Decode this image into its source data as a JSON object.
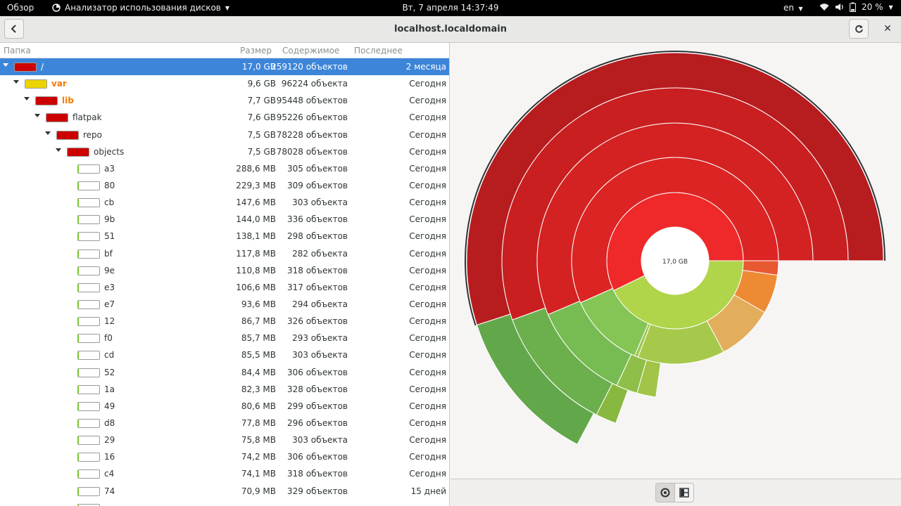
{
  "topbar": {
    "overview": "Обзор",
    "app_name": "Анализатор использования дисков",
    "clock": "Вт, 7 апреля  14:37:49",
    "lang": "en",
    "battery": "20 %"
  },
  "header": {
    "title": "localhost.localdomain"
  },
  "columns": {
    "name": "Папка",
    "size": "Размер",
    "contents": "Содержимое",
    "modified": "Последнее изменение"
  },
  "rows": [
    {
      "name": "/",
      "size": "17,0 GB",
      "contents": "259120 объектов",
      "modified": "2 месяца",
      "level": 0,
      "expander": true,
      "fill": 1.0,
      "color": "#cc0000"
    },
    {
      "name": "var",
      "size": "9,6 GB",
      "contents": "96224 объекта",
      "modified": "Сегодня",
      "level": 1,
      "expander": true,
      "fill": 1.0,
      "color": "#edd400"
    },
    {
      "name": "lib",
      "size": "7,7 GB",
      "contents": "95448 объектов",
      "modified": "Сегодня",
      "level": 2,
      "expander": true,
      "fill": 1.0,
      "color": "#cc0000"
    },
    {
      "name": "flatpak",
      "size": "7,6 GB",
      "contents": "95226 объектов",
      "modified": "Сегодня",
      "level": 3,
      "expander": true,
      "fill": 1.0,
      "color": "#cc0000"
    },
    {
      "name": "repo",
      "size": "7,5 GB",
      "contents": "78228 объектов",
      "modified": "Сегодня",
      "level": 4,
      "expander": true,
      "fill": 1.0,
      "color": "#cc0000"
    },
    {
      "name": "objects",
      "size": "7,5 GB",
      "contents": "78028 объектов",
      "modified": "Сегодня",
      "level": 5,
      "expander": true,
      "fill": 1.0,
      "color": "#cc0000"
    },
    {
      "name": "a3",
      "size": "288,6 MB",
      "contents": "305 объектов",
      "modified": "Сегодня",
      "level": 6,
      "expander": false,
      "fill": 0.04,
      "color": "#73d216"
    },
    {
      "name": "80",
      "size": "229,3 MB",
      "contents": "309 объектов",
      "modified": "Сегодня",
      "level": 6,
      "expander": false,
      "fill": 0.03,
      "color": "#73d216"
    },
    {
      "name": "cb",
      "size": "147,6 MB",
      "contents": "303 объекта",
      "modified": "Сегодня",
      "level": 6,
      "expander": false,
      "fill": 0.02,
      "color": "#73d216"
    },
    {
      "name": "9b",
      "size": "144,0 MB",
      "contents": "336 объектов",
      "modified": "Сегодня",
      "level": 6,
      "expander": false,
      "fill": 0.02,
      "color": "#73d216"
    },
    {
      "name": "51",
      "size": "138,1 MB",
      "contents": "298 объектов",
      "modified": "Сегодня",
      "level": 6,
      "expander": false,
      "fill": 0.02,
      "color": "#73d216"
    },
    {
      "name": "bf",
      "size": "117,8 MB",
      "contents": "282 объекта",
      "modified": "Сегодня",
      "level": 6,
      "expander": false,
      "fill": 0.02,
      "color": "#73d216"
    },
    {
      "name": "9e",
      "size": "110,8 MB",
      "contents": "318 объектов",
      "modified": "Сегодня",
      "level": 6,
      "expander": false,
      "fill": 0.01,
      "color": "#73d216"
    },
    {
      "name": "e3",
      "size": "106,6 MB",
      "contents": "317 объектов",
      "modified": "Сегодня",
      "level": 6,
      "expander": false,
      "fill": 0.01,
      "color": "#73d216"
    },
    {
      "name": "e7",
      "size": "93,6 MB",
      "contents": "294 объекта",
      "modified": "Сегодня",
      "level": 6,
      "expander": false,
      "fill": 0.01,
      "color": "#73d216"
    },
    {
      "name": "12",
      "size": "86,7 MB",
      "contents": "326 объектов",
      "modified": "Сегодня",
      "level": 6,
      "expander": false,
      "fill": 0.01,
      "color": "#73d216"
    },
    {
      "name": "f0",
      "size": "85,7 MB",
      "contents": "293 объекта",
      "modified": "Сегодня",
      "level": 6,
      "expander": false,
      "fill": 0.01,
      "color": "#73d216"
    },
    {
      "name": "cd",
      "size": "85,5 MB",
      "contents": "303 объекта",
      "modified": "Сегодня",
      "level": 6,
      "expander": false,
      "fill": 0.01,
      "color": "#73d216"
    },
    {
      "name": "52",
      "size": "84,4 MB",
      "contents": "306 объектов",
      "modified": "Сегодня",
      "level": 6,
      "expander": false,
      "fill": 0.01,
      "color": "#73d216"
    },
    {
      "name": "1a",
      "size": "82,3 MB",
      "contents": "328 объектов",
      "modified": "Сегодня",
      "level": 6,
      "expander": false,
      "fill": 0.01,
      "color": "#73d216"
    },
    {
      "name": "49",
      "size": "80,6 MB",
      "contents": "299 объектов",
      "modified": "Сегодня",
      "level": 6,
      "expander": false,
      "fill": 0.01,
      "color": "#73d216"
    },
    {
      "name": "d8",
      "size": "77,8 MB",
      "contents": "296 объектов",
      "modified": "Сегодня",
      "level": 6,
      "expander": false,
      "fill": 0.01,
      "color": "#73d216"
    },
    {
      "name": "29",
      "size": "75,8 MB",
      "contents": "303 объекта",
      "modified": "Сегодня",
      "level": 6,
      "expander": false,
      "fill": 0.01,
      "color": "#73d216"
    },
    {
      "name": "16",
      "size": "74,2 MB",
      "contents": "306 объектов",
      "modified": "Сегодня",
      "level": 6,
      "expander": false,
      "fill": 0.01,
      "color": "#73d216"
    },
    {
      "name": "c4",
      "size": "74,1 MB",
      "contents": "318 объектов",
      "modified": "Сегодня",
      "level": 6,
      "expander": false,
      "fill": 0.01,
      "color": "#73d216"
    },
    {
      "name": "74",
      "size": "70,9 MB",
      "contents": "329 объектов",
      "modified": "15 дней",
      "level": 6,
      "expander": false,
      "fill": 0.01,
      "color": "#73d216"
    },
    {
      "name": "",
      "size": "",
      "contents": "",
      "modified": "",
      "level": 6,
      "expander": false,
      "fill": 0.01,
      "color": "#73d216"
    }
  ],
  "chart": {
    "center_label": "17,0 GB"
  },
  "colors": {
    "selection": "#3d85d9",
    "red": "#cc0000",
    "yellow": "#edd400",
    "green": "#73d216"
  },
  "icons": {
    "app": "disk-usage-icon",
    "back": "go-previous-icon",
    "refresh": "view-refresh-icon",
    "close": "window-close-icon",
    "wifi": "wifi-icon",
    "volume": "volume-icon",
    "battery": "battery-icon",
    "rings": "rings-chart-icon",
    "treemap": "treemap-chart-icon"
  }
}
